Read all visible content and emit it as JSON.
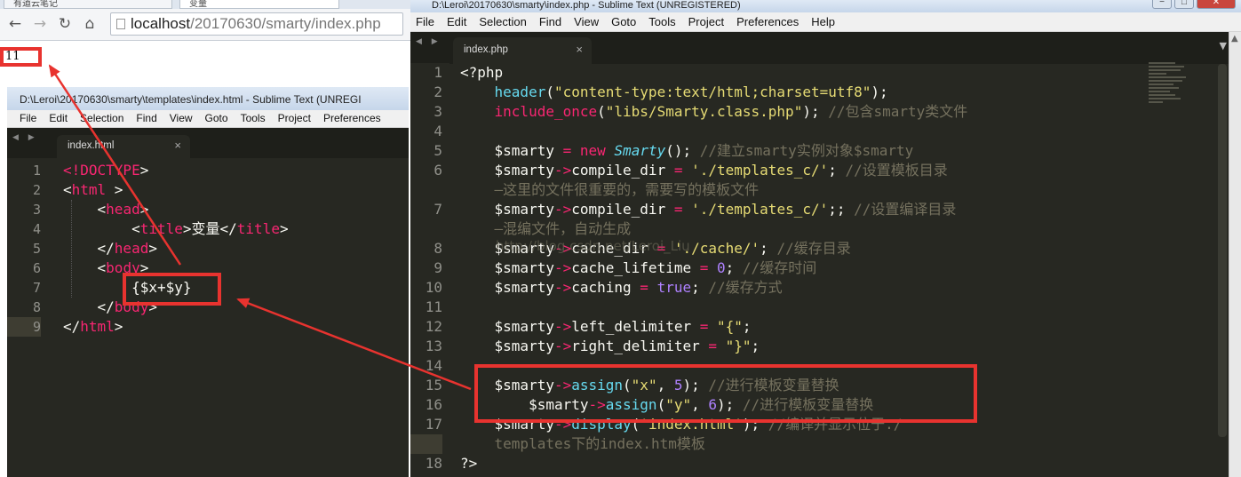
{
  "browser": {
    "tabs": [
      "有道云笔记",
      "变量"
    ],
    "url_host": "localhost",
    "url_path": "/20170630/smarty/index.php",
    "output": "11"
  },
  "left_editor": {
    "title": "D:\\Leroi\\20170630\\smarty\\templates\\index.html - Sublime Text (UNREGI",
    "menu": [
      "File",
      "Edit",
      "Selection",
      "Find",
      "View",
      "Goto",
      "Tools",
      "Project",
      "Preferences"
    ],
    "tab": "index.html",
    "lines": [
      [
        [
          "k",
          "<!DOCTYPE"
        ],
        [
          "w",
          ">"
        ]
      ],
      [
        [
          "w",
          "<"
        ],
        [
          "k",
          "html"
        ],
        [
          "w",
          " >"
        ]
      ],
      [
        [
          "w",
          "    <"
        ],
        [
          "k",
          "head"
        ],
        [
          "w",
          ">"
        ]
      ],
      [
        [
          "w",
          "        <"
        ],
        [
          "k",
          "title"
        ],
        [
          "w",
          ">变量</"
        ],
        [
          "k",
          "title"
        ],
        [
          "w",
          ">"
        ]
      ],
      [
        [
          "w",
          "    </"
        ],
        [
          "k",
          "head"
        ],
        [
          "w",
          ">"
        ]
      ],
      [
        [
          "w",
          "    <"
        ],
        [
          "k",
          "body"
        ],
        [
          "w",
          ">"
        ]
      ],
      [
        [
          "w",
          "        {$x+$y}"
        ]
      ],
      [
        [
          "w",
          "    </"
        ],
        [
          "k",
          "body"
        ],
        [
          "w",
          ">"
        ]
      ],
      [
        [
          "w",
          "</"
        ],
        [
          "k",
          "html"
        ],
        [
          "w",
          ">"
        ]
      ]
    ],
    "active_line": 9
  },
  "right_editor": {
    "title": "D:\\Leroi\\20170630\\smarty\\index.php - Sublime Text (UNREGISTERED)",
    "window_buttons": [
      "−",
      "□",
      "✕"
    ],
    "menu": [
      "File",
      "Edit",
      "Selection",
      "Find",
      "View",
      "Goto",
      "Tools",
      "Project",
      "Preferences",
      "Help"
    ],
    "tab": "index.php",
    "rows": [
      {
        "n": "1",
        "seg": [
          [
            "w",
            "<?php"
          ]
        ]
      },
      {
        "n": "2",
        "seg": [
          [
            "w",
            "    "
          ],
          [
            "f",
            "header"
          ],
          [
            "w",
            "("
          ],
          [
            "s",
            "\"content-type:text/html;charset=utf8\""
          ],
          [
            "w",
            ");"
          ]
        ]
      },
      {
        "n": "3",
        "seg": [
          [
            "w",
            "    "
          ],
          [
            "k",
            "include_once"
          ],
          [
            "w",
            "("
          ],
          [
            "s",
            "\"libs/Smarty.class.php\""
          ],
          [
            "w",
            "); "
          ],
          [
            "c",
            "//包含smarty类文件"
          ]
        ]
      },
      {
        "n": "4",
        "seg": [
          [
            "w",
            ""
          ]
        ]
      },
      {
        "n": "5",
        "seg": [
          [
            "w",
            "    $smarty "
          ],
          [
            "k",
            "="
          ],
          [
            "w",
            " "
          ],
          [
            "k",
            "new"
          ],
          [
            "w",
            " "
          ],
          [
            "cls",
            "Smarty"
          ],
          [
            "w",
            "(); "
          ],
          [
            "c",
            "//建立smarty实例对象$smarty"
          ]
        ]
      },
      {
        "n": "6",
        "seg": [
          [
            "w",
            "    $smarty"
          ],
          [
            "k",
            "->"
          ],
          [
            "w",
            "compile_dir "
          ],
          [
            "k",
            "="
          ],
          [
            "w",
            " "
          ],
          [
            "s",
            "'./templates_c/'"
          ],
          [
            "w",
            "; "
          ],
          [
            "c",
            "//设置模板目录"
          ]
        ]
      },
      {
        "n": "",
        "seg": [
          [
            "c",
            "    —这里的文件很重要的，需要写的模板文件"
          ]
        ]
      },
      {
        "n": "7",
        "seg": [
          [
            "w",
            "    $smarty"
          ],
          [
            "k",
            "->"
          ],
          [
            "w",
            "compile_dir "
          ],
          [
            "k",
            "="
          ],
          [
            "w",
            " "
          ],
          [
            "s",
            "'./templates_c/'"
          ],
          [
            "w",
            ";; "
          ],
          [
            "c",
            "//设置编译目录"
          ]
        ]
      },
      {
        "n": "",
        "seg": [
          [
            "c",
            "    —混编文件，自动生成"
          ]
        ]
      },
      {
        "n": "8",
        "seg": [
          [
            "w",
            "    $smarty"
          ],
          [
            "k",
            "->"
          ],
          [
            "w",
            "cache_dir "
          ],
          [
            "k",
            "="
          ],
          [
            "w",
            " "
          ],
          [
            "s",
            "'./cache/'"
          ],
          [
            "w",
            "; "
          ],
          [
            "c",
            "//缓存目录"
          ]
        ]
      },
      {
        "n": "9",
        "seg": [
          [
            "w",
            "    $smarty"
          ],
          [
            "k",
            "->"
          ],
          [
            "w",
            "cache_lifetime "
          ],
          [
            "k",
            "="
          ],
          [
            "w",
            " "
          ],
          [
            "n",
            "0"
          ],
          [
            "w",
            "; "
          ],
          [
            "c",
            "//缓存时间"
          ]
        ]
      },
      {
        "n": "10",
        "seg": [
          [
            "w",
            "    $smarty"
          ],
          [
            "k",
            "->"
          ],
          [
            "w",
            "caching "
          ],
          [
            "k",
            "="
          ],
          [
            "w",
            " "
          ],
          [
            "n",
            "true"
          ],
          [
            "w",
            "; "
          ],
          [
            "c",
            "//缓存方式"
          ]
        ]
      },
      {
        "n": "11",
        "seg": [
          [
            "w",
            ""
          ]
        ]
      },
      {
        "n": "12",
        "seg": [
          [
            "w",
            "    $smarty"
          ],
          [
            "k",
            "->"
          ],
          [
            "w",
            "left_delimiter "
          ],
          [
            "k",
            "="
          ],
          [
            "w",
            " "
          ],
          [
            "s",
            "\"{\""
          ],
          [
            "w",
            ";"
          ]
        ]
      },
      {
        "n": "13",
        "seg": [
          [
            "w",
            "    $smarty"
          ],
          [
            "k",
            "->"
          ],
          [
            "w",
            "right_delimiter "
          ],
          [
            "k",
            "="
          ],
          [
            "w",
            " "
          ],
          [
            "s",
            "\"}\""
          ],
          [
            "w",
            ";"
          ]
        ]
      },
      {
        "n": "14",
        "seg": [
          [
            "w",
            ""
          ]
        ]
      },
      {
        "n": "15",
        "seg": [
          [
            "w",
            "    $smarty"
          ],
          [
            "k",
            "->"
          ],
          [
            "f",
            "assign"
          ],
          [
            "w",
            "("
          ],
          [
            "s",
            "\"x\""
          ],
          [
            "w",
            ", "
          ],
          [
            "n",
            "5"
          ],
          [
            "w",
            "); "
          ],
          [
            "c",
            "//进行模板变量替换"
          ]
        ]
      },
      {
        "n": "16",
        "seg": [
          [
            "w",
            "        $smarty"
          ],
          [
            "k",
            "->"
          ],
          [
            "f",
            "assign"
          ],
          [
            "w",
            "("
          ],
          [
            "s",
            "\"y\""
          ],
          [
            "w",
            ", "
          ],
          [
            "n",
            "6"
          ],
          [
            "w",
            "); "
          ],
          [
            "c",
            "//进行模板变量替换"
          ]
        ]
      },
      {
        "n": "17",
        "seg": [
          [
            "w",
            "    $smarty"
          ],
          [
            "k",
            "->"
          ],
          [
            "f",
            "display"
          ],
          [
            "w",
            "("
          ],
          [
            "s",
            "'index.html'"
          ],
          [
            "w",
            "); "
          ],
          [
            "c",
            "//编译并显示位于./"
          ]
        ]
      },
      {
        "n": "",
        "seg": [
          [
            "c",
            "    templates下的index.htm模板"
          ]
        ]
      },
      {
        "n": "18",
        "seg": [
          [
            "w",
            "?>"
          ]
        ]
      }
    ],
    "active_row": 20,
    "ghost_text": "http://blog.csdn.net/Leroi_Liu"
  },
  "colors": {
    "editor_bg": "#272822",
    "annotation_red": "#e8332f",
    "keyword": "#f92672",
    "function": "#66d9ef",
    "string": "#e6db74",
    "comment": "#75715e",
    "number": "#ae81ff"
  }
}
